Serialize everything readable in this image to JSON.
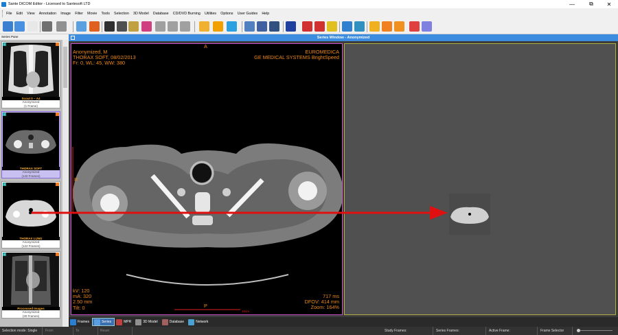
{
  "window": {
    "title": "Sante DICOM Editor - Licensed to Santesoft LTD",
    "minimize_glyph": "—",
    "restore_glyph": "⧉",
    "close_glyph": "✕"
  },
  "menu": [
    "File",
    "Edit",
    "View",
    "Annotation",
    "Image",
    "Filter",
    "Movie",
    "Tools",
    "Selection",
    "3D Model",
    "Database",
    "CD/DVD Burning",
    "Utilities",
    "Options",
    "User Guides",
    "Help"
  ],
  "toolbar": {
    "buttons": [
      "search-icon",
      "network-icon",
      "open-file-icon",
      "print-icon",
      "print-preview-icon",
      "layout-icon",
      "settings-icon",
      "eye-icon",
      "stamp-icon",
      "color-film-icon",
      "palette-icon",
      "grid-1-icon",
      "grid-2-icon",
      "grid-3-icon",
      "hand-icon",
      "brightness-icon",
      "rotate-icon",
      "zoom-icon",
      "zoom-fit-icon",
      "pan-icon",
      "rectangle-icon",
      "ellipse-roi-icon",
      "rect-roi-icon",
      "color-wheel-icon",
      "line-icon",
      "arrow-icon",
      "angle-icon",
      "protractor-icon",
      "cobb-angle-icon",
      "eraser-icon",
      "text-icon"
    ]
  },
  "series_pane": {
    "header": "Series Pane",
    "items": [
      {
        "index": "1",
        "name": "Scout  0 ~ A4",
        "anon": "Anonymized",
        "frames": "(1 Frame)",
        "selected": false
      },
      {
        "index": "2",
        "name": "THORAX SOFT",
        "anon": "Anonymized",
        "frames": "(140 Frames)",
        "selected": true
      },
      {
        "index": "3",
        "name": "THORAX LUNG",
        "anon": "Anonymized",
        "frames": "(122 Frames)",
        "selected": false
      },
      {
        "index": "4",
        "name": "Processed Images",
        "anon": "Anonymized",
        "frames": "(30 Frames)",
        "selected": false
      }
    ]
  },
  "series_window": {
    "title": "Series Window - Anonymized"
  },
  "overlay": {
    "top_left": [
      "Anonymized, M",
      "THORAX SOFT, 08/02/2013",
      "Fr: 0, WL: 45, WW: 380"
    ],
    "top_right": [
      "EUROMEDICA",
      "GE MEDICAL SYSTEMS BrightSpeed"
    ],
    "bottom_left": [
      "kV: 120",
      "mA: 320",
      "2.50 mm",
      "Tilt: 0"
    ],
    "bottom_right": [
      "717 ms",
      "DFOV: 414 mm",
      "Zoom: 164%"
    ],
    "orient_top": "A",
    "orient_left": "R",
    "orient_bottom": "P",
    "scale_label": "10cm"
  },
  "bottom_tabs": [
    {
      "label": "Frames",
      "icon": "frames-icon",
      "active": false
    },
    {
      "label": "Series",
      "icon": "series-icon",
      "active": true
    },
    {
      "label": "MPR",
      "icon": "mpr-icon",
      "active": false
    },
    {
      "label": "3D Model",
      "icon": "3d-model-icon",
      "active": false
    },
    {
      "label": "Database",
      "icon": "database-icon",
      "active": false
    },
    {
      "label": "Network",
      "icon": "network-icon",
      "active": false
    }
  ],
  "status": {
    "selection_mode": "Selection mode: Single",
    "from": "From",
    "to": "To",
    "reset": "Reset",
    "study_frames": "Study Frames:",
    "series_frames": "Series Frames:",
    "active_frame": "Active Frame:",
    "frame_selector": "Frame Selector"
  },
  "colors": {
    "accent": "#3c8de0",
    "overlay_text": "#f08a14",
    "selected_frame_border": "#d050d0",
    "arrow": "#e01010"
  }
}
